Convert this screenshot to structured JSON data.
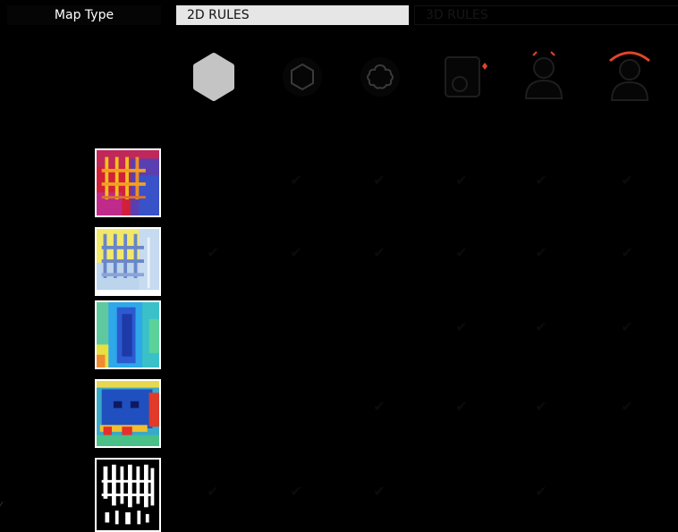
{
  "header": {
    "label": "Map Type",
    "tabs": [
      {
        "label": "2D RULES",
        "active": true
      },
      {
        "label": "3D RULES",
        "active": false
      }
    ]
  },
  "column_icons": [
    "hexagon-filled-icon",
    "hexagon-outline-icon",
    "flower-outline-icon",
    "camera-building-icon",
    "person-alert-icon",
    "person-ring-icon"
  ],
  "rows": [
    {
      "map": "heatmap-red-blue",
      "checks": [
        false,
        true,
        true,
        true,
        true,
        true
      ]
    },
    {
      "map": "heatmap-yellow-blue",
      "checks": [
        true,
        true,
        true,
        true,
        true,
        true
      ]
    },
    {
      "map": "heatmap-blue-green",
      "checks": [
        false,
        false,
        false,
        true,
        true,
        true
      ]
    },
    {
      "map": "heatmap-green-blue",
      "checks": [
        false,
        false,
        true,
        true,
        true,
        true
      ]
    },
    {
      "map": "binary-black-white",
      "checks": [
        true,
        true,
        true,
        false,
        true,
        false
      ]
    }
  ],
  "check_glyph": "✔",
  "colors": {
    "background": "#000000",
    "tab_active": "#e6e6e6",
    "accent_red": "#e0452a",
    "icon_fill": "#c4c4c4"
  }
}
